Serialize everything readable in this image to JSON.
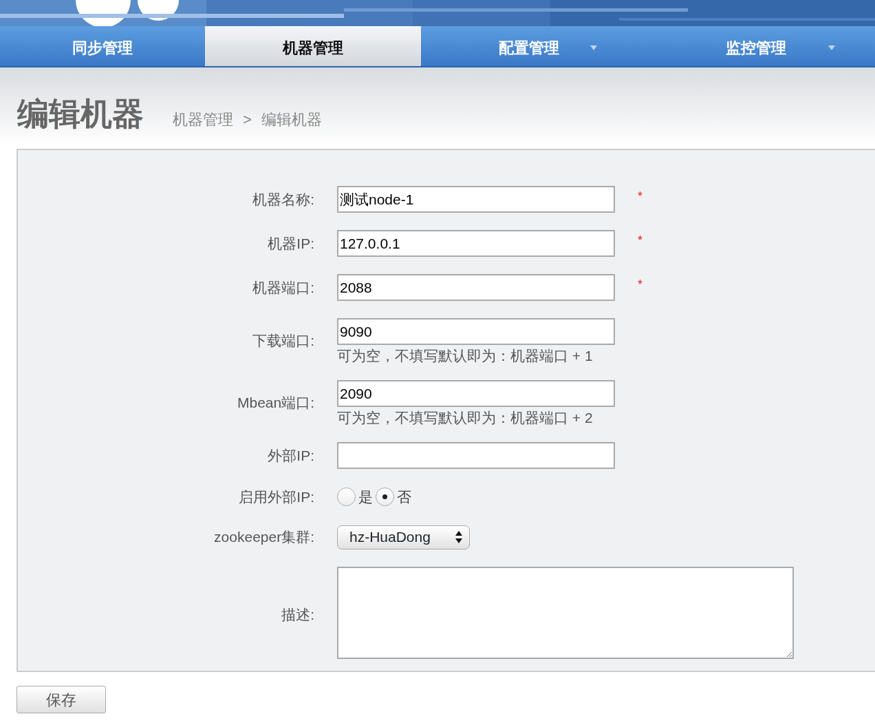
{
  "nav": {
    "tabs": [
      {
        "label": "同步管理",
        "selected": false,
        "dropdown": false
      },
      {
        "label": "机器管理",
        "selected": true,
        "dropdown": false
      },
      {
        "label": "配置管理",
        "selected": false,
        "dropdown": true
      },
      {
        "label": "监控管理",
        "selected": false,
        "dropdown": true
      }
    ]
  },
  "page_title": "编辑机器",
  "breadcrumb": {
    "items": [
      "机器管理",
      "编辑机器"
    ],
    "separator": ">"
  },
  "form": {
    "fields": [
      {
        "kind": "text",
        "label": "机器名称:",
        "value": "测试node-1",
        "required_mark": "*"
      },
      {
        "kind": "text",
        "label": "机器IP:",
        "value": "127.0.0.1",
        "required_mark": "*"
      },
      {
        "kind": "text",
        "label": "机器端口:",
        "value": "2088",
        "required_mark": "*"
      },
      {
        "kind": "text",
        "label": "下载端口:",
        "value": "9090",
        "hint": "可为空，不填写默认即为：机器端口 + 1"
      },
      {
        "kind": "text",
        "label": "Mbean端口:",
        "value": "2090",
        "hint": "可为空，不填写默认即为：机器端口 + 2"
      },
      {
        "kind": "text",
        "label": "外部IP:"
      },
      {
        "kind": "radio",
        "label": "启用外部IP:",
        "options": [
          {
            "label": "是",
            "selected": false
          },
          {
            "label": "否",
            "selected": true
          }
        ]
      },
      {
        "kind": "select",
        "label": "zookeeper集群:",
        "value": "hz-HuaDong"
      },
      {
        "kind": "textarea",
        "label": "描述:"
      }
    ]
  },
  "save_button": "保存"
}
